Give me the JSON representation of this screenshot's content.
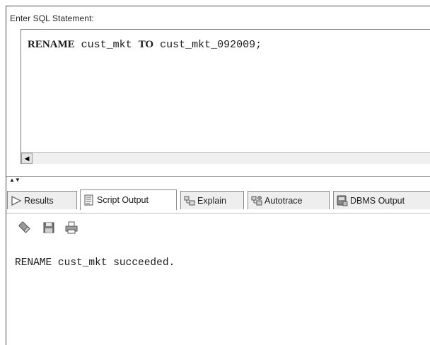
{
  "editor": {
    "label": "Enter SQL Statement:",
    "sql": {
      "kw_rename": "RENAME",
      "old_name": " cust_mkt ",
      "kw_to": "TO",
      "new_name": " cust_mkt_092009;"
    }
  },
  "tabs": [
    {
      "label": "Results",
      "icon": "results-icon",
      "active": false
    },
    {
      "label": "Script Output",
      "icon": "script-output-icon",
      "active": true
    },
    {
      "label": "Explain",
      "icon": "explain-icon",
      "active": false
    },
    {
      "label": "Autotrace",
      "icon": "autotrace-icon",
      "active": false
    },
    {
      "label": "DBMS Output",
      "icon": "dbms-output-icon",
      "active": false
    }
  ],
  "toolbar": {
    "icons": [
      "eraser-icon",
      "save-icon",
      "print-icon"
    ]
  },
  "output": {
    "text": "RENAME cust_mkt succeeded."
  }
}
